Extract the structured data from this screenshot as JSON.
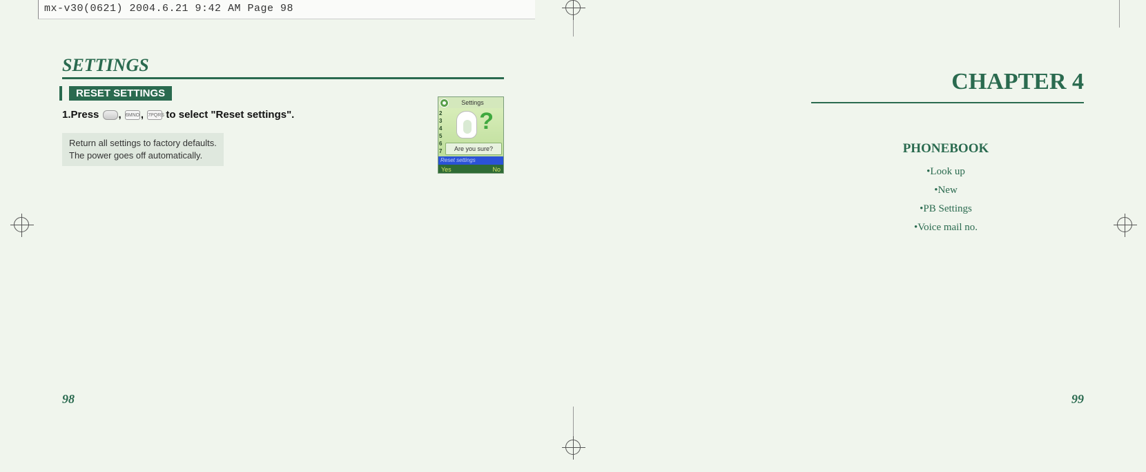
{
  "header": {
    "text": "mx-v30(0621)  2004.6.21  9:42 AM  Page 98"
  },
  "left_page": {
    "title": "SETTINGS",
    "section_badge": "RESET SETTINGS",
    "instruction_prefix": "1.Press ",
    "instruction_suffix": " to select \"Reset settings\".",
    "key1": "",
    "key2": "6MNO",
    "key3": "7PQRS",
    "note_line1": "Return all settings to factory defaults.",
    "note_line2": "The power goes off automatically.",
    "page_number": "98"
  },
  "phone": {
    "title": "Settings",
    "numbers": [
      "2",
      "3",
      "4",
      "5",
      "6",
      "7"
    ],
    "popup": "Are you sure?",
    "highlight": "Reset settings",
    "softkey_left": "Yes",
    "softkey_right": "No"
  },
  "right_page": {
    "chapter": "CHAPTER 4",
    "heading": "PHONEBOOK",
    "items": [
      "•Look up",
      "•New",
      "•PB Settings",
      "•Voice mail no."
    ],
    "page_number": "99"
  }
}
